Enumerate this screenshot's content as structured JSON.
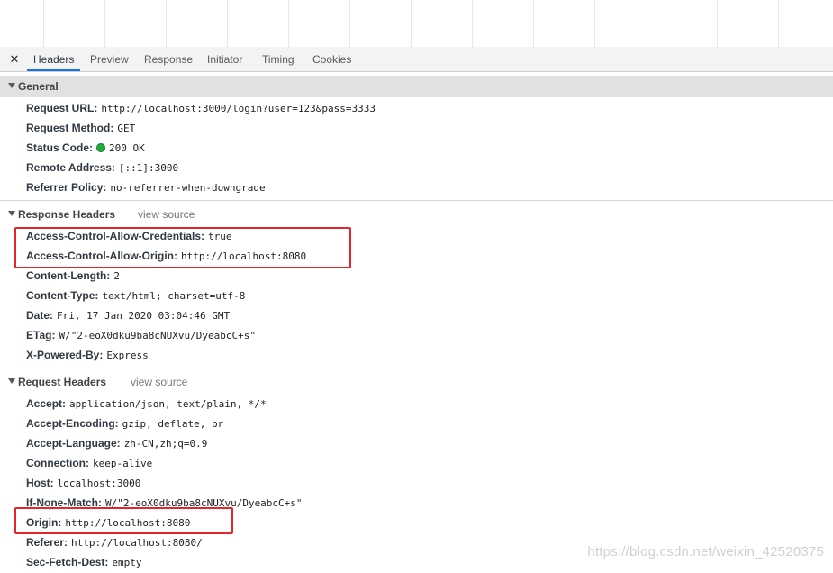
{
  "tabs": [
    {
      "label": "Headers",
      "active": true
    },
    {
      "label": "Preview",
      "active": false
    },
    {
      "label": "Response",
      "active": false
    },
    {
      "label": "Initiator",
      "active": false
    },
    {
      "label": "Timing",
      "active": false
    },
    {
      "label": "Cookies",
      "active": false
    }
  ],
  "close_glyph": "✕",
  "general": {
    "title": "General",
    "rows": [
      {
        "name": "Request URL:",
        "value": "http://localhost:3000/login?user=123&pass=3333"
      },
      {
        "name": "Request Method:",
        "value": "GET"
      },
      {
        "name": "Status Code:",
        "value": "200 OK"
      },
      {
        "name": "Remote Address:",
        "value": "[::1]:3000"
      },
      {
        "name": "Referrer Policy:",
        "value": "no-referrer-when-downgrade"
      }
    ]
  },
  "response_headers": {
    "title": "Response Headers",
    "view_source": "view source",
    "rows": [
      {
        "name": "Access-Control-Allow-Credentials:",
        "value": "true"
      },
      {
        "name": "Access-Control-Allow-Origin:",
        "value": "http://localhost:8080"
      },
      {
        "name": "Content-Length:",
        "value": "2"
      },
      {
        "name": "Content-Type:",
        "value": "text/html; charset=utf-8"
      },
      {
        "name": "Date:",
        "value": "Fri, 17 Jan 2020 03:04:46 GMT"
      },
      {
        "name": "ETag:",
        "value": "W/\"2-eoX0dku9ba8cNUXvu/DyeabcC+s\""
      },
      {
        "name": "X-Powered-By:",
        "value": "Express"
      }
    ]
  },
  "request_headers": {
    "title": "Request Headers",
    "view_source": "view source",
    "rows": [
      {
        "name": "Accept:",
        "value": "application/json, text/plain, */*"
      },
      {
        "name": "Accept-Encoding:",
        "value": "gzip, deflate, br"
      },
      {
        "name": "Accept-Language:",
        "value": "zh-CN,zh;q=0.9"
      },
      {
        "name": "Connection:",
        "value": "keep-alive"
      },
      {
        "name": "Host:",
        "value": "localhost:3000"
      },
      {
        "name": "If-None-Match:",
        "value": "W/\"2-eoX0dku9ba8cNUXvu/DyeabcC+s\""
      },
      {
        "name": "Origin:",
        "value": "http://localhost:8080"
      },
      {
        "name": "Referer:",
        "value": "http://localhost:8080/"
      },
      {
        "name": "Sec-Fetch-Dest:",
        "value": "empty"
      }
    ]
  },
  "watermark": "https://blog.csdn.net/weixin_42520375",
  "colors": {
    "active_tab": "#1a73e8",
    "highlight": "#e6252a",
    "status_ok": "#26a840"
  }
}
